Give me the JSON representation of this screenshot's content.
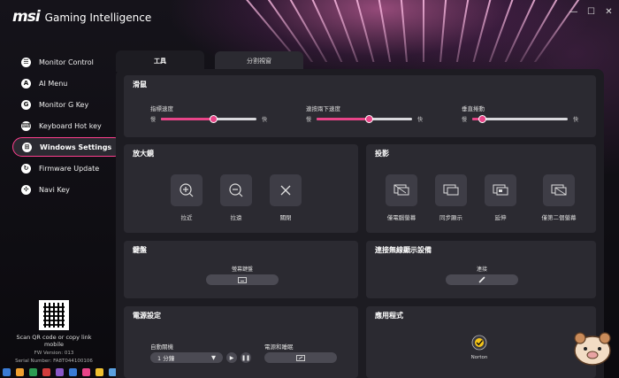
{
  "header": {
    "brand": "msi",
    "app_name": "Gaming Intelligence",
    "minimize_glyph": "—",
    "restore_glyph": "☐",
    "close_glyph": "✕"
  },
  "sidebar": {
    "items": [
      {
        "label": "Monitor Control",
        "icon": "monitor-icon",
        "icon_glyph": "☰"
      },
      {
        "label": "AI Menu",
        "icon": "ai-icon",
        "icon_glyph": "A"
      },
      {
        "label": "Monitor G Key",
        "icon": "g-key-icon",
        "icon_glyph": "G"
      },
      {
        "label": "Keyboard Hot key",
        "icon": "keyboard-icon",
        "icon_glyph": "⌨"
      },
      {
        "label": "Windows Settings",
        "icon": "windows-icon",
        "icon_glyph": "⊞",
        "active": true
      },
      {
        "label": "Firmware Update",
        "icon": "firmware-icon",
        "icon_glyph": "↻"
      },
      {
        "label": "Navi Key",
        "icon": "navi-key-icon",
        "icon_glyph": "✣"
      }
    ],
    "qr": {
      "scan_text": "Scan QR code or copy link mobile",
      "fw_version": "FW Version: 013",
      "serial": "Serial Number: FA8T044100106"
    }
  },
  "tabs": [
    {
      "label": "工具",
      "active": true
    },
    {
      "label": "分割視窗",
      "active": false
    }
  ],
  "mouse": {
    "title": "滑鼠",
    "sliders": [
      {
        "label": "指標速度",
        "min_label": "慢",
        "max_label": "快",
        "value": 0.55
      },
      {
        "label": "連按兩下速度",
        "min_label": "慢",
        "max_label": "快",
        "value": 0.55
      },
      {
        "label": "垂直捲動",
        "min_label": "慢",
        "max_label": "快",
        "value": 0.1
      }
    ]
  },
  "magnifier": {
    "title": "放大鏡",
    "buttons": [
      {
        "label": "拉近",
        "icon": "zoom-in-icon"
      },
      {
        "label": "拉遠",
        "icon": "zoom-out-icon"
      },
      {
        "label": "關閉",
        "icon": "close-icon"
      }
    ]
  },
  "projection": {
    "title": "投影",
    "buttons": [
      {
        "label": "僅電腦螢幕",
        "icon": "pc-screen-only-icon"
      },
      {
        "label": "同步顯示",
        "icon": "duplicate-icon"
      },
      {
        "label": "延伸",
        "icon": "extend-icon"
      },
      {
        "label": "僅第二個螢幕",
        "icon": "second-screen-only-icon"
      }
    ]
  },
  "keyboard": {
    "title": "鍵盤",
    "screen_keyboard_label": "螢幕鍵盤"
  },
  "wireless_display": {
    "title": "連接無線顯示設備",
    "connect_label": "連接"
  },
  "power": {
    "title": "電源設定",
    "auto_shutdown_label": "自動關機",
    "auto_shutdown_value": "1 分鐘",
    "power_sleep_label": "電源和睡眠"
  },
  "apps": {
    "title": "應用程式",
    "items": [
      {
        "label": "Norton"
      }
    ]
  },
  "colors": {
    "accent": "#e84488",
    "panel": "#1d1c22",
    "section": "#2b2a31"
  }
}
